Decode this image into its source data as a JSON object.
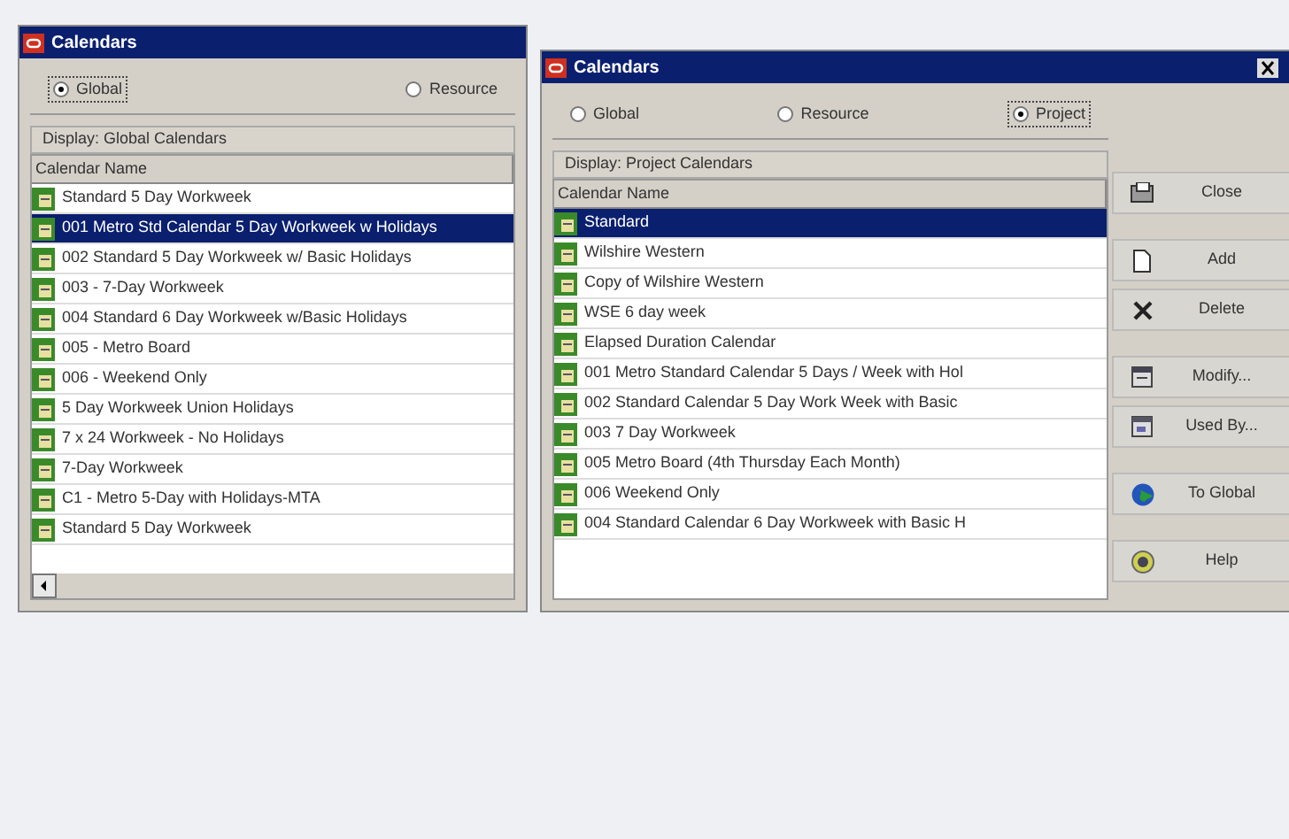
{
  "windows": [
    {
      "title": "Calendars",
      "radios": [
        {
          "label": "Global",
          "selected": true
        },
        {
          "label": "Resource",
          "selected": false
        }
      ],
      "display": "Display: Global Calendars",
      "column": "Calendar Name",
      "rows": [
        {
          "name": "Standard 5 Day Workweek",
          "selected": false
        },
        {
          "name": "001 Metro Std Calendar 5 Day Workweek w Holidays",
          "selected": true
        },
        {
          "name": "002 Standard 5 Day Workweek w/ Basic Holidays",
          "selected": false
        },
        {
          "name": "003 - 7-Day Workweek",
          "selected": false
        },
        {
          "name": "004 Standard 6 Day Workweek w/Basic Holidays",
          "selected": false
        },
        {
          "name": "005 - Metro Board",
          "selected": false
        },
        {
          "name": "006 - Weekend Only",
          "selected": false
        },
        {
          "name": "5 Day Workweek Union Holidays",
          "selected": false
        },
        {
          "name": "7 x 24 Workweek - No Holidays",
          "selected": false
        },
        {
          "name": "7-Day Workweek",
          "selected": false
        },
        {
          "name": "C1 - Metro 5-Day with Holidays-MTA",
          "selected": false
        },
        {
          "name": "Standard 5 Day Workweek",
          "selected": false
        }
      ]
    },
    {
      "title": "Calendars",
      "radios": [
        {
          "label": "Global",
          "selected": false
        },
        {
          "label": "Resource",
          "selected": false
        },
        {
          "label": "Project",
          "selected": true
        }
      ],
      "display": "Display: Project Calendars",
      "column": "Calendar Name",
      "rows": [
        {
          "name": "Standard",
          "selected": true
        },
        {
          "name": "Wilshire Western",
          "selected": false
        },
        {
          "name": "Copy of Wilshire Western",
          "selected": false
        },
        {
          "name": "WSE 6 day week",
          "selected": false
        },
        {
          "name": "Elapsed Duration Calendar",
          "selected": false
        },
        {
          "name": "001 Metro Standard Calendar 5 Days / Week with Hol",
          "selected": false
        },
        {
          "name": "002 Standard Calendar 5 Day Work Week with Basic",
          "selected": false
        },
        {
          "name": "003 7 Day Workweek",
          "selected": false
        },
        {
          "name": "005 Metro Board (4th Thursday Each Month)",
          "selected": false
        },
        {
          "name": "006 Weekend Only",
          "selected": false
        },
        {
          "name": "004 Standard Calendar 6 Day Workweek with Basic H",
          "selected": false
        }
      ],
      "buttons": [
        {
          "label": "Close",
          "kind": "close"
        },
        {
          "label": "Add",
          "kind": "add"
        },
        {
          "label": "Delete",
          "kind": "delete"
        },
        {
          "label": "Modify...",
          "kind": "modify"
        },
        {
          "label": "Used By...",
          "kind": "usedby"
        },
        {
          "label": "To Global",
          "kind": "global"
        },
        {
          "label": "Help",
          "kind": "help"
        }
      ]
    }
  ]
}
